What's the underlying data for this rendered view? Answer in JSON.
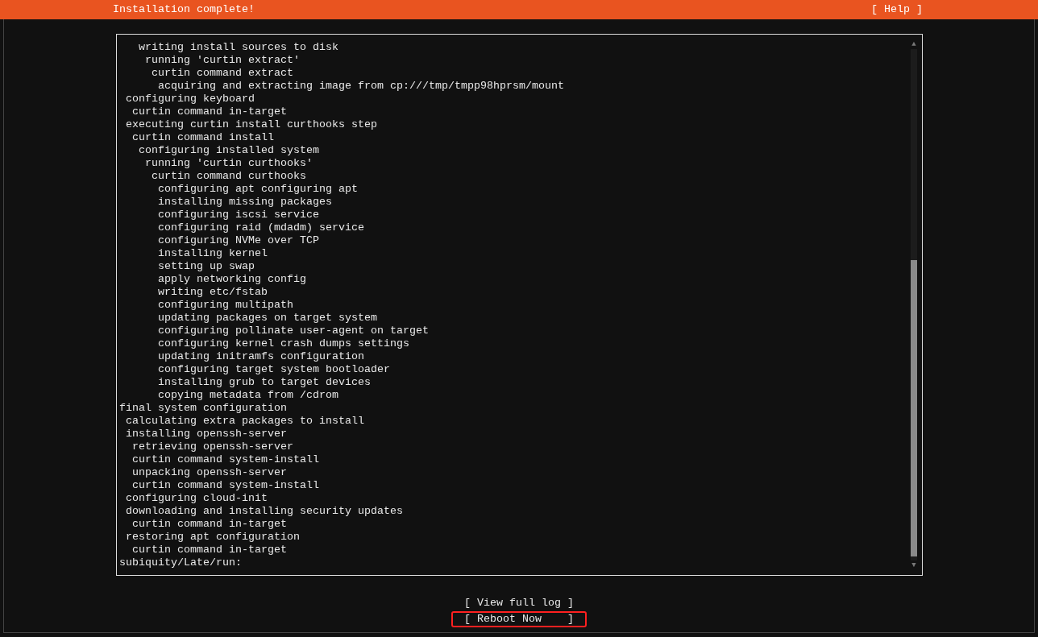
{
  "header": {
    "title": "Installation complete!",
    "help": "[ Help ]"
  },
  "log": {
    "scroll_up": "▲",
    "scroll_down": "▼",
    "lines": [
      "   writing install sources to disk",
      "    running 'curtin extract'",
      "     curtin command extract",
      "      acquiring and extracting image from cp:///tmp/tmpp98hprsm/mount",
      " configuring keyboard",
      "  curtin command in-target",
      " executing curtin install curthooks step",
      "  curtin command install",
      "   configuring installed system",
      "    running 'curtin curthooks'",
      "     curtin command curthooks",
      "      configuring apt configuring apt",
      "      installing missing packages",
      "      configuring iscsi service",
      "      configuring raid (mdadm) service",
      "      configuring NVMe over TCP",
      "      installing kernel",
      "      setting up swap",
      "      apply networking config",
      "      writing etc/fstab",
      "      configuring multipath",
      "      updating packages on target system",
      "      configuring pollinate user-agent on target",
      "      configuring kernel crash dumps settings",
      "      updating initramfs configuration",
      "      configuring target system bootloader",
      "      installing grub to target devices",
      "      copying metadata from /cdrom",
      "final system configuration",
      " calculating extra packages to install",
      " installing openssh-server",
      "  retrieving openssh-server",
      "  curtin command system-install",
      "  unpacking openssh-server",
      "  curtin command system-install",
      " configuring cloud-init",
      " downloading and installing security updates",
      "  curtin command in-target",
      " restoring apt configuration",
      "  curtin command in-target",
      "subiquity/Late/run:"
    ]
  },
  "buttons": [
    {
      "label": "[ View full log ]",
      "highlighted": false
    },
    {
      "label": "[ Reboot Now    ]",
      "highlighted": true
    }
  ]
}
